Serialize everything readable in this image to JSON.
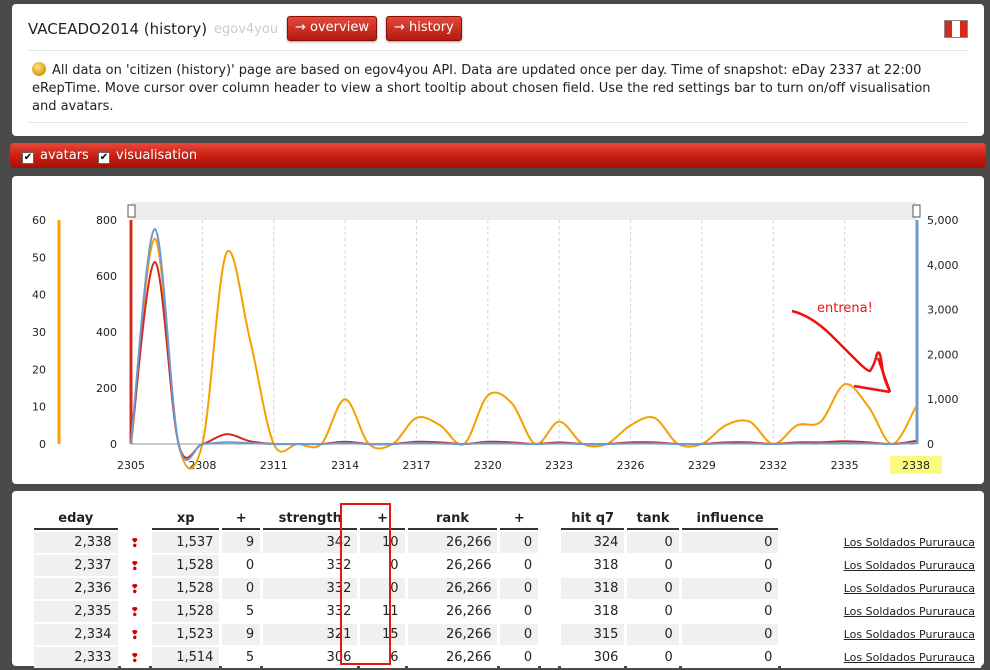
{
  "header": {
    "title": "VACEADO2014 (history)",
    "subtitle": "egov4you",
    "buttons": [
      {
        "label": "→ overview"
      },
      {
        "label": "→ history"
      }
    ],
    "info": "All data on 'citizen (history)' page are based on egov4you API. Data are updated once per day. Time of snapshot: eDay 2337 at 22:00 eRepTime. Move cursor over column header to view a short tooltip about chosen field. Use the red settings bar to turn on/off visualisation and avatars.",
    "flag_colors": [
      "#d52b1e",
      "#ffffff",
      "#d52b1e"
    ]
  },
  "settings": {
    "avatars": {
      "label": "avatars",
      "checked": true
    },
    "visualisation": {
      "label": "visualisation",
      "checked": true
    }
  },
  "chart_data": {
    "type": "line",
    "x": [
      2305,
      2306,
      2307,
      2308,
      2309,
      2310,
      2311,
      2312,
      2313,
      2314,
      2315,
      2316,
      2317,
      2318,
      2319,
      2320,
      2321,
      2322,
      2323,
      2324,
      2325,
      2326,
      2327,
      2328,
      2329,
      2330,
      2331,
      2332,
      2333,
      2334,
      2335,
      2336,
      2337,
      2338
    ],
    "x_ticks": [
      "2305",
      "2308",
      "2311",
      "2314",
      "2317",
      "2320",
      "2323",
      "2326",
      "2329",
      "2332",
      "2335",
      "2338"
    ],
    "highlight_tick": "2338",
    "left_axis_outer": {
      "ticks": [
        "0",
        "10",
        "20",
        "30",
        "40",
        "50",
        "60"
      ],
      "range": [
        0,
        60
      ],
      "color": "#f5a000"
    },
    "left_axis_inner": {
      "ticks": [
        "0",
        "200",
        "400",
        "600",
        "800"
      ],
      "range": [
        0,
        800
      ],
      "color": "#d42a1e"
    },
    "right_axis": {
      "ticks": [
        "0",
        "1,000",
        "2,000",
        "3,000",
        "4,000",
        "5,000"
      ],
      "range": [
        0,
        5000
      ],
      "color": "#6b9bd0"
    },
    "series": [
      {
        "axis": "left_outer",
        "color": "#f5a000",
        "values": [
          0,
          55,
          0,
          0,
          51,
          28,
          0,
          0,
          0,
          12,
          0,
          0,
          7,
          5,
          0,
          13,
          11,
          0,
          6,
          0,
          0,
          5,
          7,
          0,
          0,
          5,
          6,
          0,
          5,
          6,
          16,
          10,
          0,
          10
        ]
      },
      {
        "axis": "left_inner",
        "color": "#d42a1e",
        "values": [
          0,
          650,
          0,
          0,
          35,
          10,
          0,
          0,
          0,
          8,
          0,
          0,
          8,
          6,
          0,
          8,
          6,
          0,
          6,
          0,
          0,
          6,
          6,
          0,
          0,
          6,
          6,
          0,
          6,
          6,
          10,
          6,
          0,
          11
        ]
      },
      {
        "axis": "right",
        "color": "#6b9bd0",
        "values": [
          0,
          4800,
          0,
          0,
          40,
          20,
          0,
          0,
          0,
          20,
          0,
          0,
          20,
          10,
          0,
          20,
          10,
          0,
          10,
          0,
          0,
          10,
          10,
          0,
          0,
          10,
          10,
          0,
          10,
          10,
          20,
          10,
          0,
          20
        ]
      }
    ],
    "annotation": "entrena!"
  },
  "table": {
    "headers": [
      "eday",
      "",
      "xp",
      "+",
      "strength",
      "+",
      "rank",
      "+",
      "",
      "hit q7",
      "tank",
      "influence",
      ""
    ],
    "rows": [
      {
        "eday": "2,338",
        "xp": "1,537",
        "xp_plus": "9",
        "strength": "342",
        "str_plus": "10",
        "rank": "26,266",
        "rank_plus": "0",
        "hit": "324",
        "tank": "0",
        "influence": "0",
        "unit": "Los Soldados Pururauca"
      },
      {
        "eday": "2,337",
        "xp": "1,528",
        "xp_plus": "0",
        "strength": "332",
        "str_plus": "0",
        "rank": "26,266",
        "rank_plus": "0",
        "hit": "318",
        "tank": "0",
        "influence": "0",
        "unit": "Los Soldados Pururauca"
      },
      {
        "eday": "2,336",
        "xp": "1,528",
        "xp_plus": "0",
        "strength": "332",
        "str_plus": "0",
        "rank": "26,266",
        "rank_plus": "0",
        "hit": "318",
        "tank": "0",
        "influence": "0",
        "unit": "Los Soldados Pururauca"
      },
      {
        "eday": "2,335",
        "xp": "1,528",
        "xp_plus": "5",
        "strength": "332",
        "str_plus": "11",
        "rank": "26,266",
        "rank_plus": "0",
        "hit": "318",
        "tank": "0",
        "influence": "0",
        "unit": "Los Soldados Pururauca"
      },
      {
        "eday": "2,334",
        "xp": "1,523",
        "xp_plus": "9",
        "strength": "321",
        "str_plus": "15",
        "rank": "26,266",
        "rank_plus": "0",
        "hit": "315",
        "tank": "0",
        "influence": "0",
        "unit": "Los Soldados Pururauca"
      },
      {
        "eday": "2,333",
        "xp": "1,514",
        "xp_plus": "5",
        "strength": "306",
        "str_plus": "6",
        "rank": "26,266",
        "rank_plus": "0",
        "hit": "306",
        "tank": "0",
        "influence": "0",
        "unit": "Los Soldados Pururauca"
      }
    ]
  }
}
